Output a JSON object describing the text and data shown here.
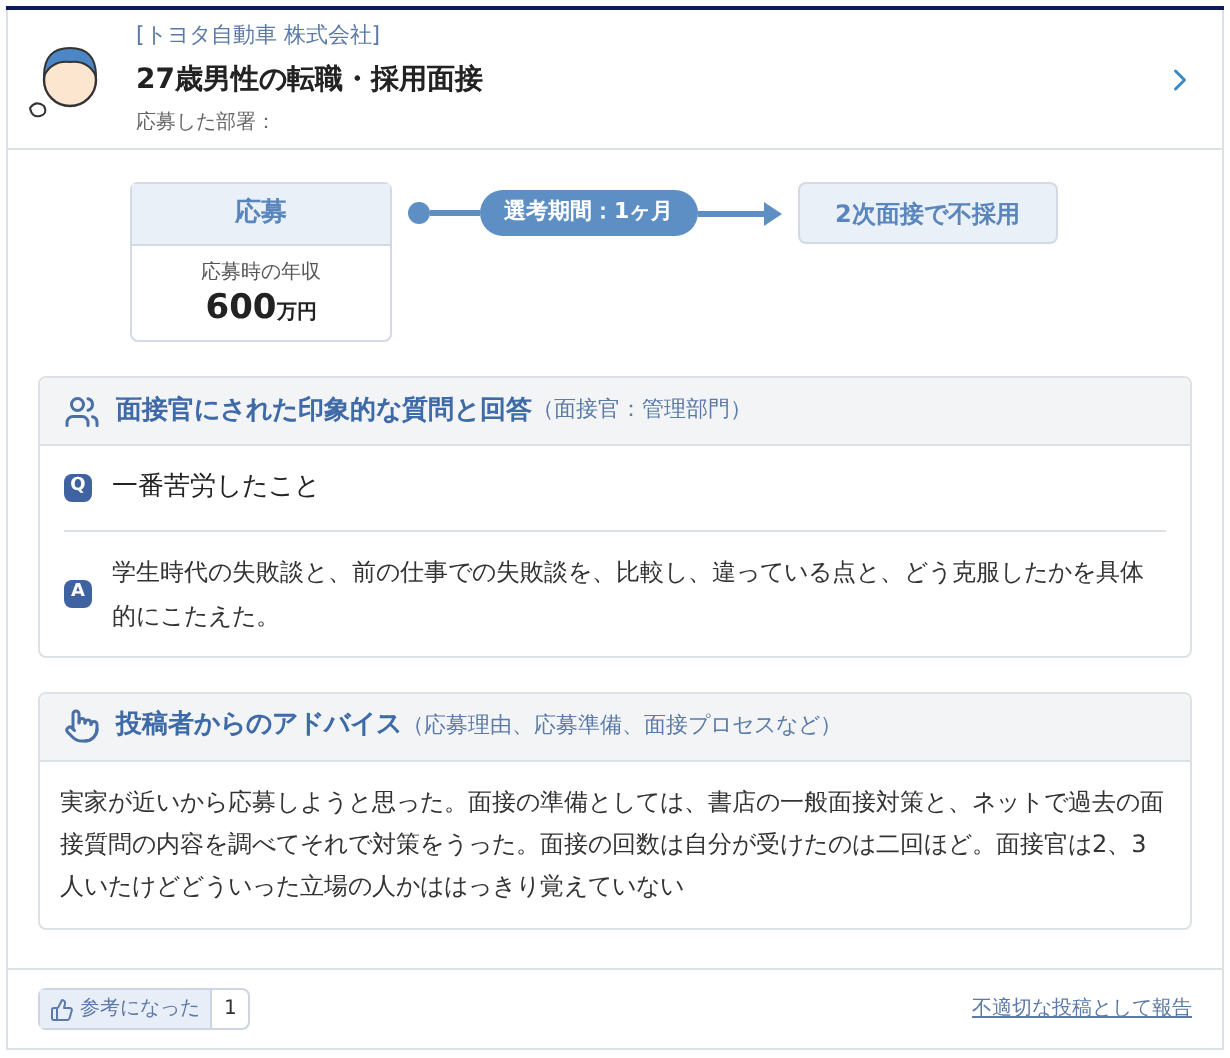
{
  "header": {
    "company": "[トヨタ自動車 株式会社]",
    "title": "27歳男性の転職・採用面接",
    "department": "応募した部署："
  },
  "flow": {
    "start": {
      "label": "応募",
      "caption": "応募時の年収",
      "amount": "600",
      "unit": "万円"
    },
    "period": "選考期間：1ヶ月",
    "result": "2次面接で不採用"
  },
  "sections": [
    {
      "kind": "qa",
      "title": "面接官にされた印象的な質問と回答",
      "note": "（面接官：管理部門）",
      "question_mark": "Q",
      "question": "一番苦労したこと",
      "answer_mark": "A",
      "answer": "学生時代の失敗談と、前の仕事での失敗談を、比較し、違っている点と、どう克服したかを具体的にこたえた。"
    },
    {
      "kind": "advice",
      "title": "投稿者からのアドバイス",
      "note": "（応募理由、応募準備、面接プロセスなど）",
      "body": "実家が近いから応募しようと思った。面接の準備としては、書店の一般面接対策と、ネットで過去の面接質問の内容を調べてそれで対策をうった。面接の回数は自分が受けたのは二回ほど。面接官は2、3人いたけどどういった立場の人かははっきり覚えていない"
    }
  ],
  "footer": {
    "helpful": "参考になった",
    "count": "1",
    "report": "不適切な投稿として報告"
  }
}
